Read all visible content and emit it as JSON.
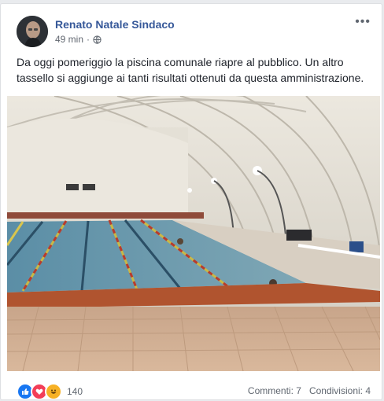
{
  "post": {
    "author": "Renato Natale Sindaco",
    "time": "49 min",
    "privacy_icon": "globe-icon",
    "text": "Da oggi pomeriggio la piscina comunale riapre al pubblico. Un altro tassello si aggiunge ai tanti risultati ottenuti da questa amministrazione.",
    "more_label": "•••"
  },
  "footer": {
    "reaction_icons": [
      "like-icon",
      "love-icon",
      "haha-icon"
    ],
    "reaction_count": "140",
    "comments": "Commenti: 7",
    "shares": "Condivisioni: 4"
  },
  "colors": {
    "author": "#365899",
    "like": "#1877f2",
    "love": "#f33e58",
    "haha": "#f7b125"
  }
}
